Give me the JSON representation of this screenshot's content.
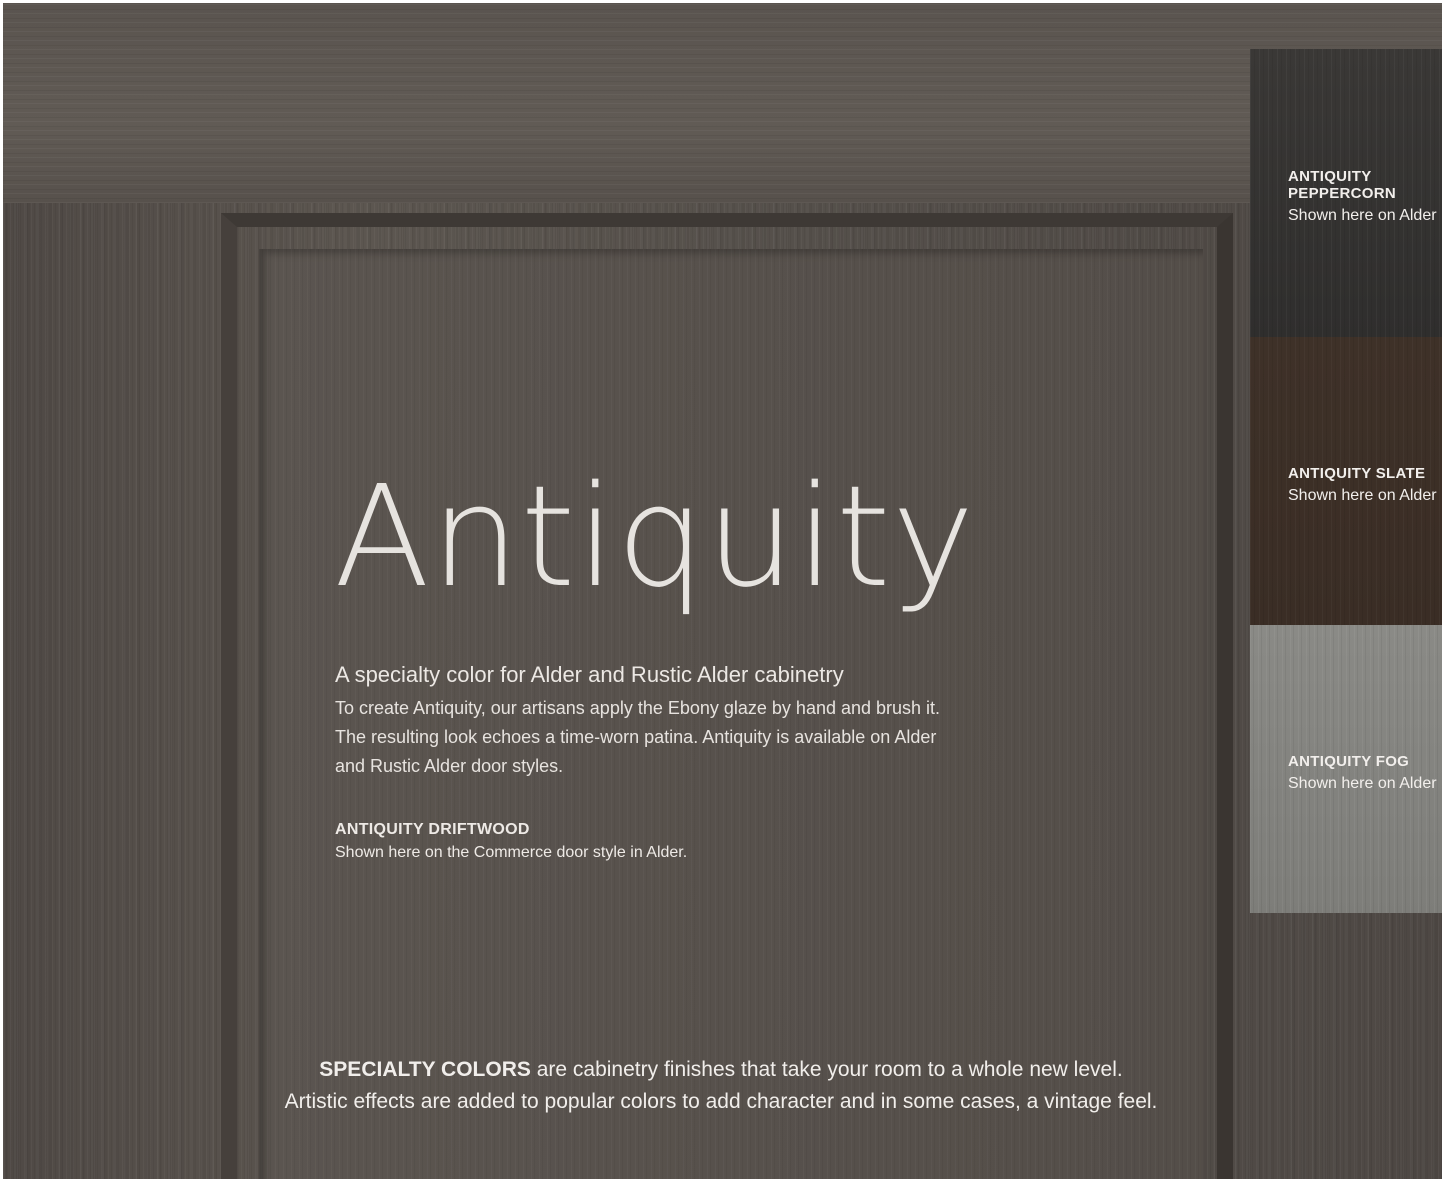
{
  "title": "Antiquity",
  "subtitle": "A specialty color for Alder and Rustic Alder cabinetry",
  "body_lines": [
    "To create Antiquity, our artisans apply the Ebony glaze by hand and brush it.",
    "The resulting look echoes a time-worn patina. Antiquity is available on Alder",
    "and Rustic Alder door styles."
  ],
  "featured_finish": {
    "name": "ANTIQUITY DRIFTWOOD",
    "description": "Shown here on the Commerce door style in Alder."
  },
  "swatches": [
    {
      "name_line1": "ANTIQUITY",
      "name_line2": "PEPPERCORN",
      "description": "Shown here on Alder",
      "color": "#333130"
    },
    {
      "name_line1": "ANTIQUITY SLATE",
      "name_line2": "",
      "description": "Shown here on Alder",
      "color": "#3c2f27"
    },
    {
      "name_line1": "ANTIQUITY FOG",
      "name_line2": "",
      "description": "Shown here on Alder",
      "color": "#838380"
    }
  ],
  "footer": {
    "bold_lead": "SPECIALTY COLORS",
    "line1_rest": " are cabinetry finishes that take your room to a whole new level.",
    "line2": "Artistic effects are added to popular colors to add character and in some cases, a vintage feel."
  }
}
